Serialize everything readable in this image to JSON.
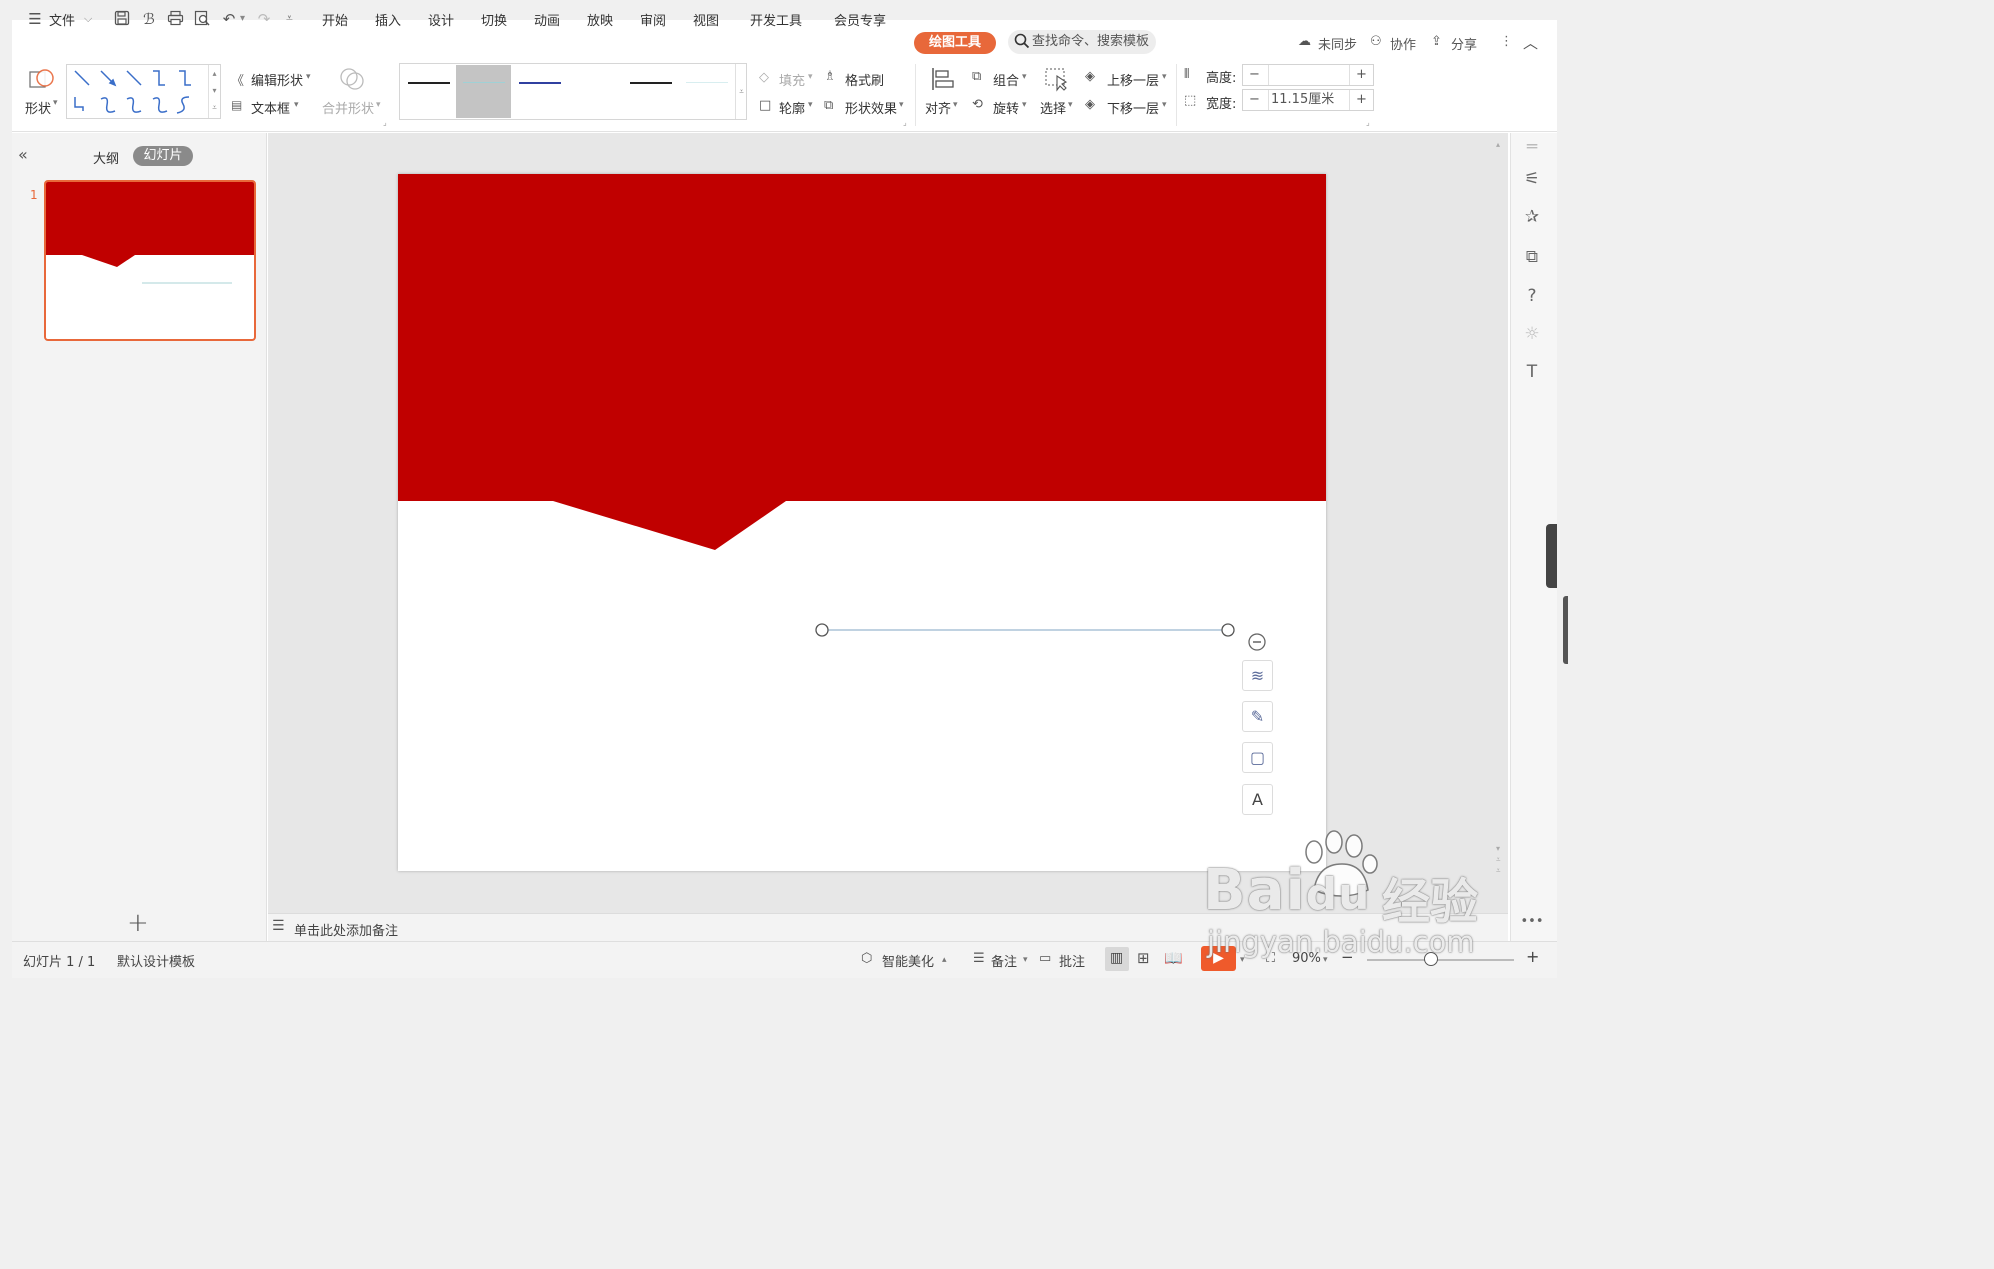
{
  "menubar": {
    "file_label": "文件",
    "tabs": [
      "开始",
      "插入",
      "设计",
      "切换",
      "动画",
      "放映",
      "审阅",
      "视图",
      "开发工具",
      "会员专享"
    ],
    "active_tab": "绘图工具",
    "search_placeholder": "查找命令、搜索模板",
    "sync_label": "未同步",
    "collab_label": "协作",
    "share_label": "分享"
  },
  "ribbon": {
    "shape_label": "形状",
    "edit_shape_label": "编辑形状",
    "textbox_label": "文本框",
    "merge_shape_label": "合并形状",
    "fill_label": "填充",
    "format_painter_label": "格式刷",
    "outline_label": "轮廓",
    "shape_effect_label": "形状效果",
    "align_label": "对齐",
    "group_label": "组合",
    "rotate_label": "旋转",
    "select_label": "选择",
    "bring_forward_label": "上移一层",
    "send_backward_label": "下移一层",
    "height_label": "高度:",
    "height_value": "",
    "width_label": "宽度:",
    "width_value": "11.15厘米",
    "minus": "−",
    "plus": "+"
  },
  "left_panel": {
    "outline_tab": "大纲",
    "slides_tab": "幻灯片",
    "slide_number": "1",
    "add_slide": "+"
  },
  "notes_placeholder": "单击此处添加备注",
  "status": {
    "slide_counter": "幻灯片 1 / 1",
    "template": "默认设计模板",
    "beautify": "智能美化",
    "notes": "备注",
    "comments": "批注",
    "zoom": "90%"
  },
  "watermark": {
    "brand": "Bai",
    "brand_tail": "du",
    "cn": "经验",
    "url": "jingyan.baidu.com"
  },
  "colors": {
    "slide_red": "#c00000",
    "accent_orange": "#e8683a",
    "line_color": "#9bb7cf"
  }
}
